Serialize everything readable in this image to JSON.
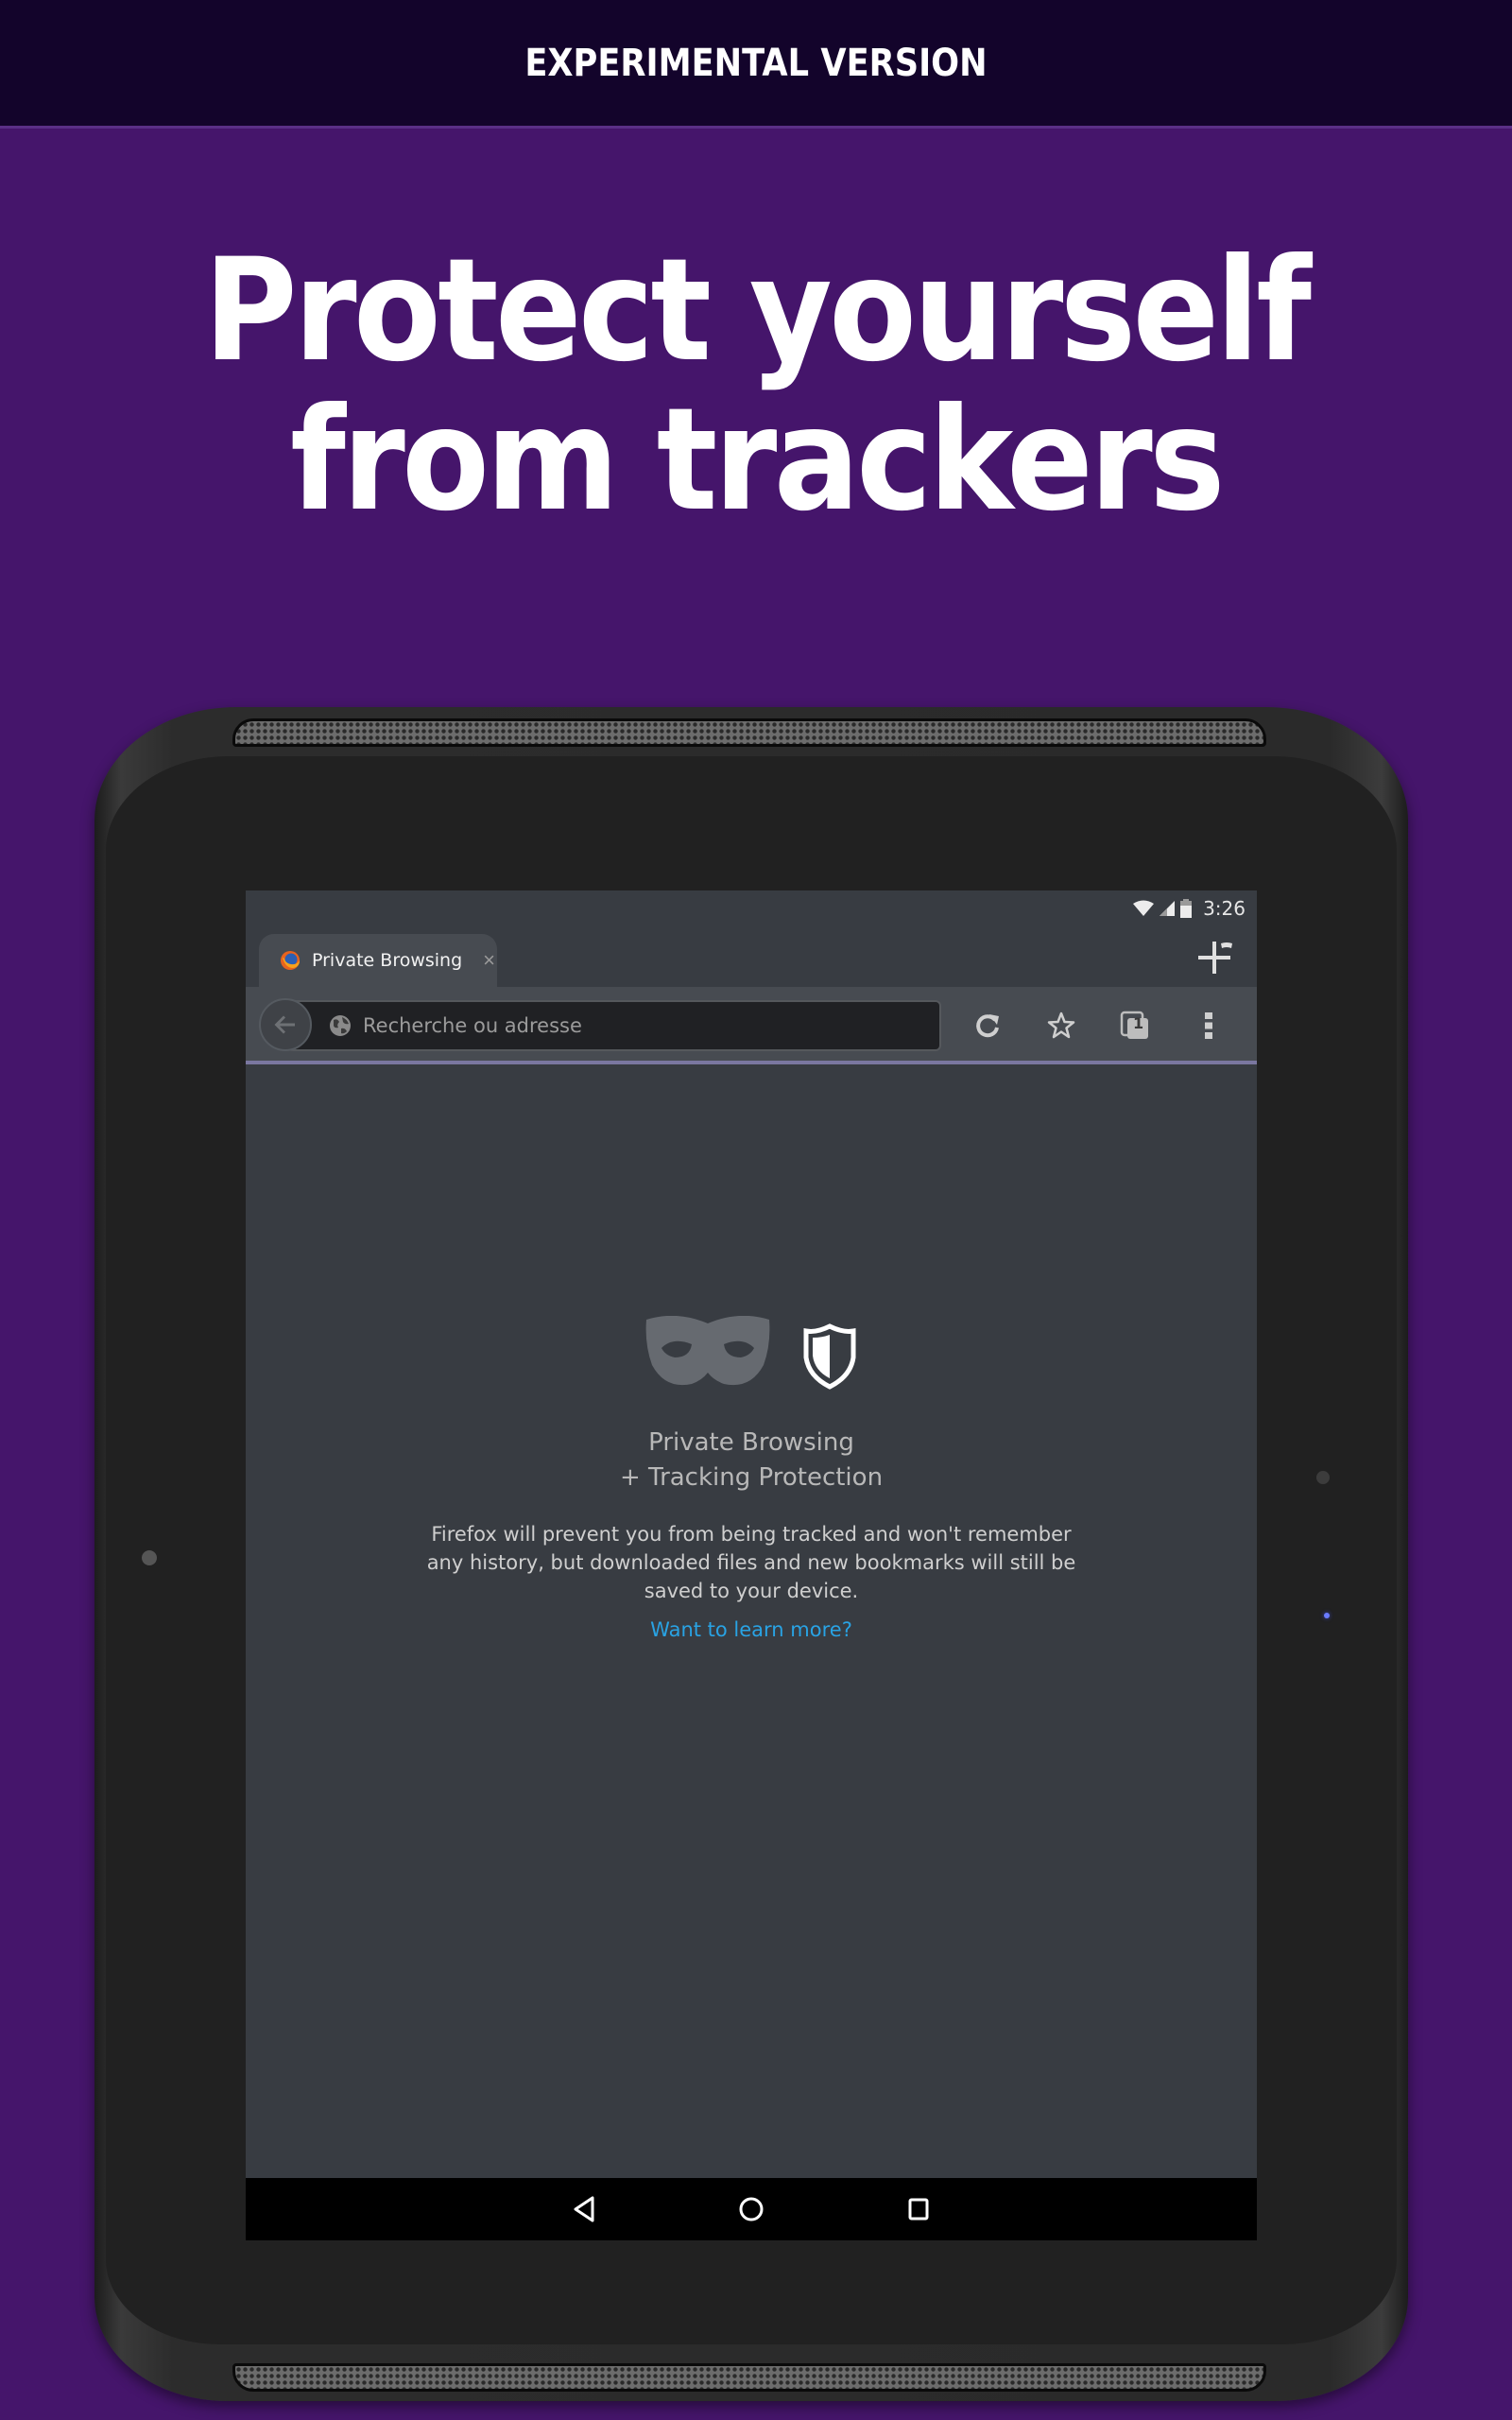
{
  "banner": {
    "label": "EXPERIMENTAL VERSION"
  },
  "headline": {
    "line1": "Protect yourself",
    "line2": "from trackers"
  },
  "colors": {
    "banner_bg": "#13042b",
    "page_bg": "#45156b",
    "link": "#29a3e4",
    "screen_bg": "#383c42"
  },
  "status_bar": {
    "icons": [
      "wifi-icon",
      "signal-icon",
      "battery-icon"
    ],
    "time": "3:26"
  },
  "tab": {
    "favicon": "firefox-icon",
    "title": "Private Browsing",
    "close_label": "×"
  },
  "new_tab": {
    "icon": "new-private-tab-icon"
  },
  "url_bar": {
    "back_icon": "back-arrow-icon",
    "globe_icon": "globe-icon",
    "placeholder": "Recherche ou adresse"
  },
  "toolbar": {
    "reload_icon": "reload-icon",
    "bookmark_icon": "star-icon",
    "tabs_icon": "tabs-icon",
    "tabs_count": "1",
    "menu_icon": "overflow-menu-icon"
  },
  "private_page": {
    "mask_icon": "private-mask-icon",
    "shield_icon": "shield-icon",
    "title_line1": "Private Browsing",
    "title_line2": "+ Tracking Protection",
    "description": "Firefox will prevent you from being tracked and won't remember any history, but downloaded files and new bookmarks will still be saved to your device.",
    "link": "Want to learn more?"
  },
  "nav_bar": {
    "back": "nav-back-icon",
    "home": "nav-home-icon",
    "recents": "nav-recents-icon"
  }
}
